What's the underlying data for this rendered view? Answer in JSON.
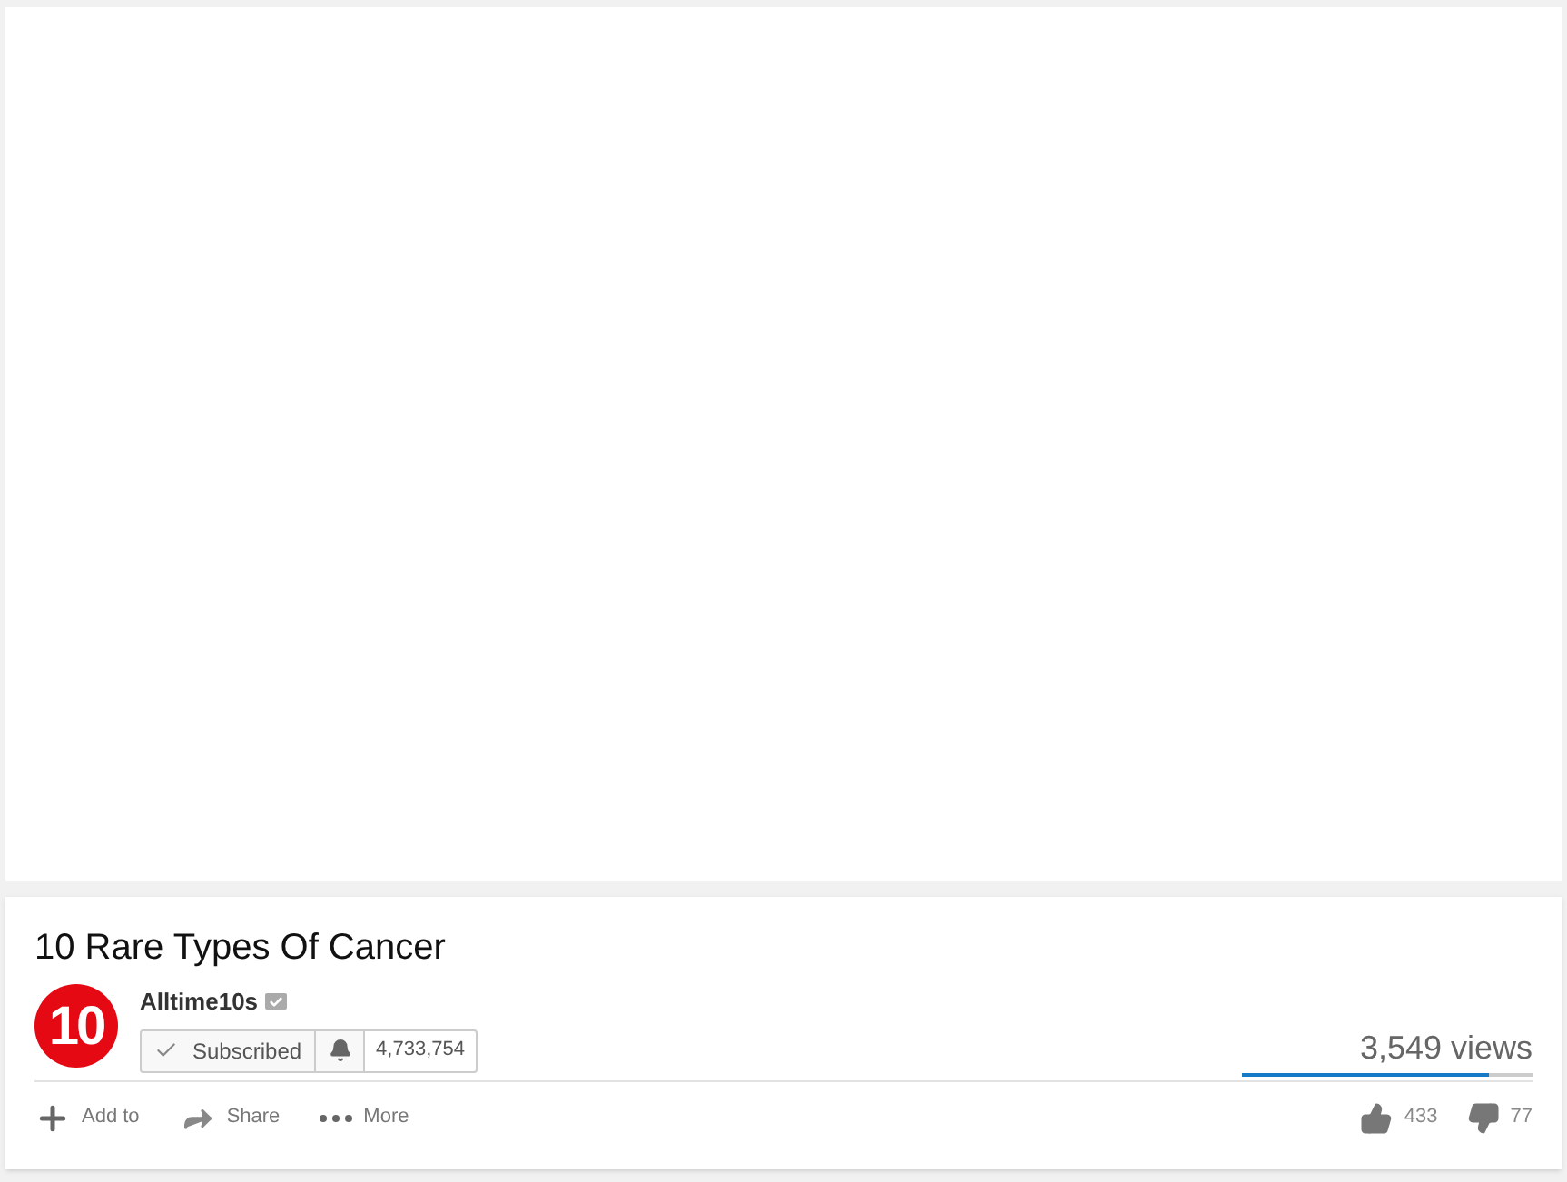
{
  "video": {
    "title": "10 Rare Types Of Cancer"
  },
  "channel": {
    "logo_text": "10",
    "name": "Alltime10s",
    "verified": true,
    "subscribed": true,
    "subscribe_label": "Subscribed",
    "subscriber_count": "4,733,754"
  },
  "views": "3,549 views",
  "sentiment": {
    "level": 0.85
  },
  "actions": [
    {
      "kind": "add",
      "label": "Add to"
    },
    {
      "kind": "share",
      "label": "Share"
    },
    {
      "kind": "more",
      "label": "More"
    }
  ],
  "likes": "433",
  "dislikes": "77"
}
